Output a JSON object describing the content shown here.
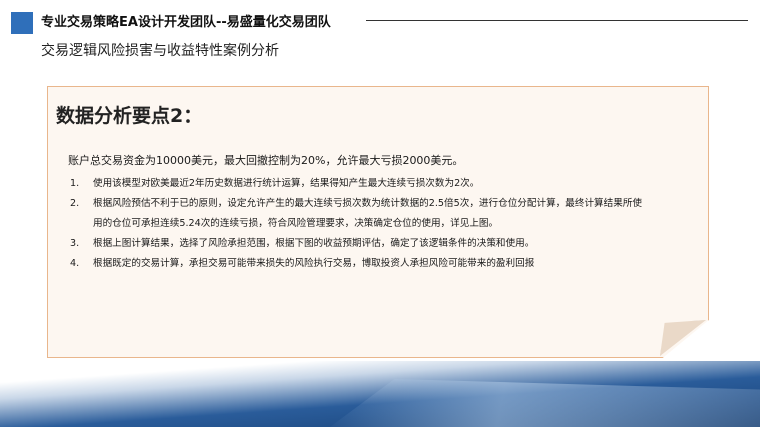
{
  "header": {
    "title": "专业交易策略EA设计开发团队--易盛量化交易团队",
    "subtitle": "交易逻辑风险损害与收益特性案例分析",
    "accent_color": "#2f6fba"
  },
  "note": {
    "heading": "数据分析要点2：",
    "intro": "账户总交易资金为10000美元，最大回撤控制为20%，允许最大亏损2000美元。",
    "items": [
      {
        "num": "1.",
        "text": "使用该模型对欧美最近2年历史数据进行统计运算，结果得知产生最大连续亏损次数为2次。"
      },
      {
        "num": "2.",
        "text": "根据风险预估不利于已的原则，设定允许产生的最大连续亏损次数为统计数据的2.5倍5次，进行仓位分配计算，最终计算结果所使用的仓位可承担连续5.24次的连续亏损，符合风险管理要求，决策确定仓位的使用，详见上图。"
      },
      {
        "num": "3.",
        "text": "根据上图计算结果，选择了风险承担范围，根据下图的收益预期评估，确定了该逻辑条件的决策和使用。"
      },
      {
        "num": "4.",
        "text": "根据既定的交易计算，承担交易可能带来损失的风险执行交易，博取投资人承担风险可能带来的盈利回报"
      }
    ],
    "card_color": "#fdf7f1",
    "border_color": "#e9b68c"
  },
  "footer": {
    "band_color": "#2a5c9a"
  }
}
